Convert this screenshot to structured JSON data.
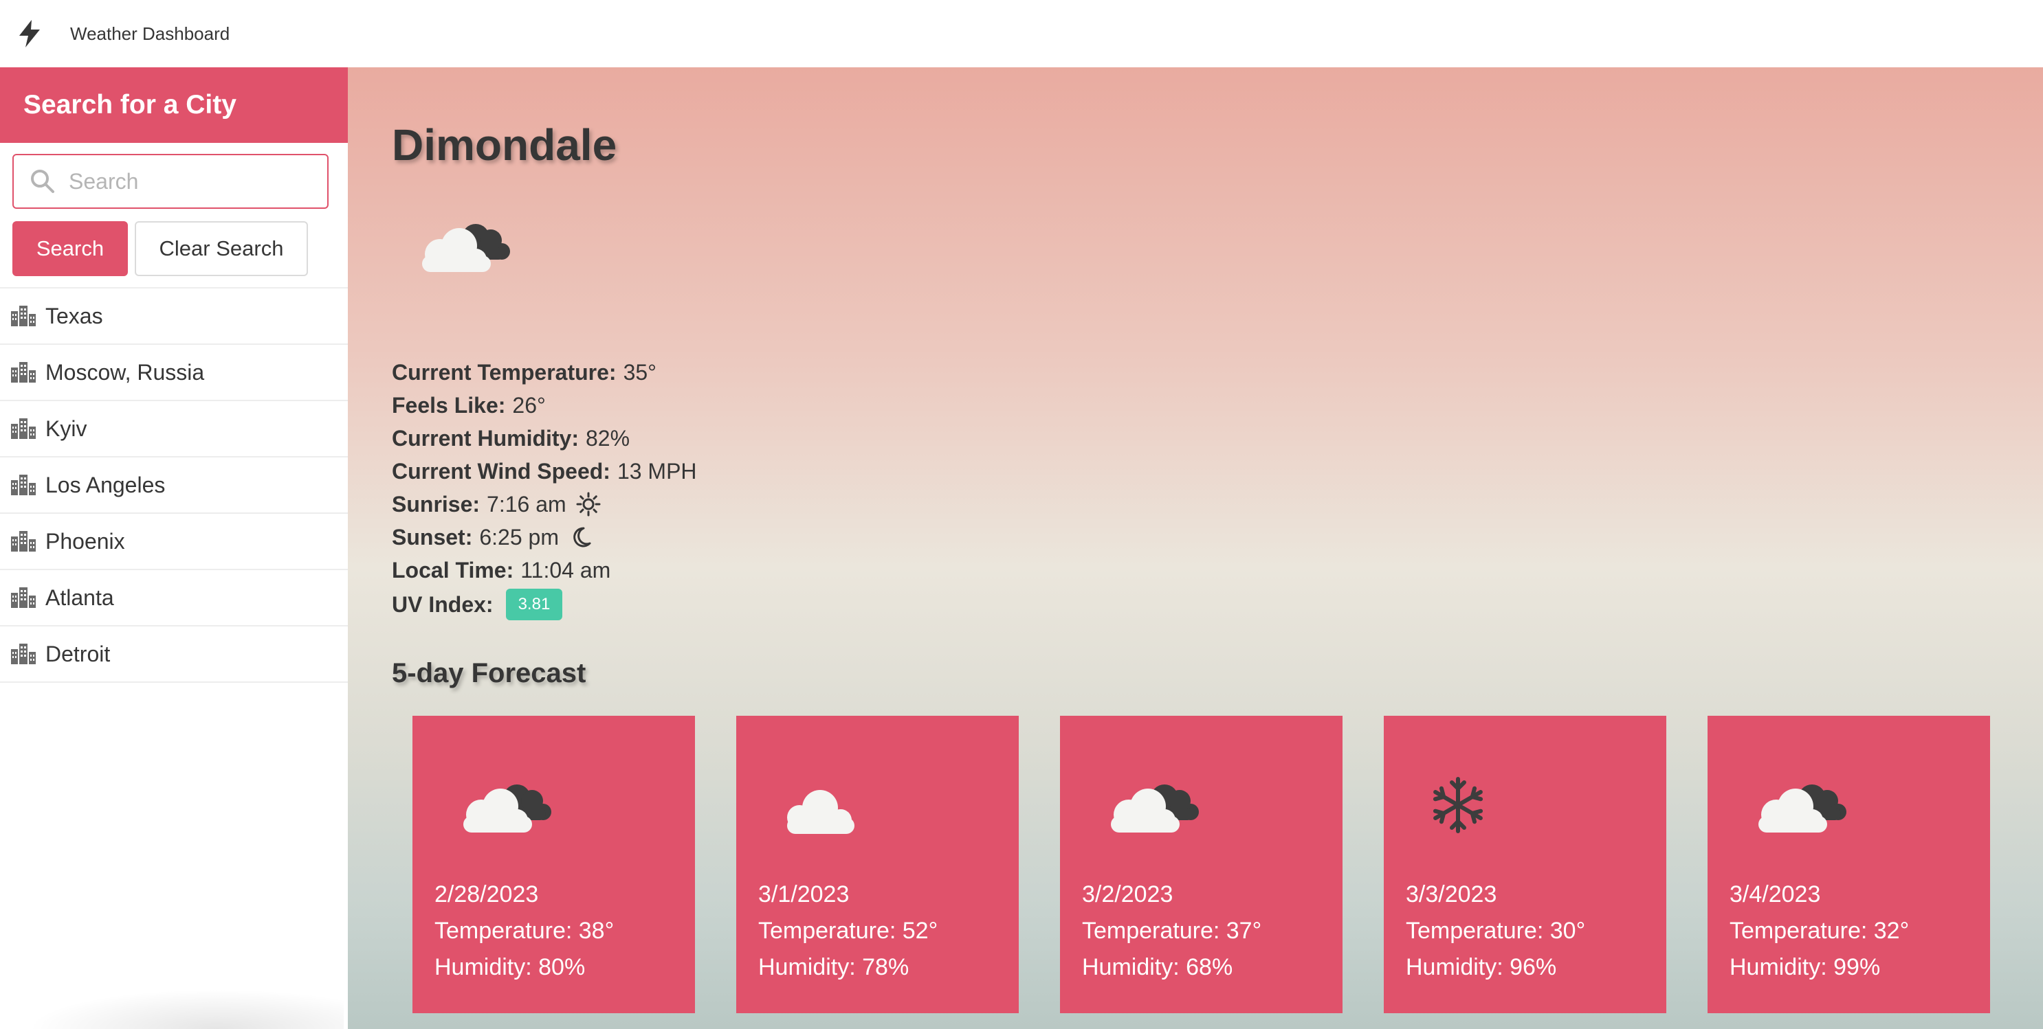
{
  "app": {
    "title": "Weather Dashboard",
    "brand_icon": "bolt-icon"
  },
  "sidebar": {
    "header": "Search for a City",
    "search": {
      "placeholder": "Search",
      "value": ""
    },
    "search_button": "Search",
    "clear_button": "Clear Search",
    "cities": [
      {
        "label": "Texas",
        "icon": "city-icon"
      },
      {
        "label": "Moscow, Russia",
        "icon": "city-icon"
      },
      {
        "label": "Kyiv",
        "icon": "city-icon"
      },
      {
        "label": "Los Angeles",
        "icon": "city-icon"
      },
      {
        "label": "Phoenix",
        "icon": "city-icon"
      },
      {
        "label": "Atlanta",
        "icon": "city-icon"
      },
      {
        "label": "Detroit",
        "icon": "city-icon"
      }
    ]
  },
  "current": {
    "city": "Dimondale",
    "icon": "cloudy-icon",
    "temperature_label": "Current Temperature:",
    "temperature": "35°",
    "feels_like_label": "Feels Like:",
    "feels_like": "26°",
    "humidity_label": "Current Humidity:",
    "humidity": "82%",
    "wind_label": "Current Wind Speed:",
    "wind": "13 MPH",
    "sunrise_label": "Sunrise:",
    "sunrise": "7:16 am",
    "sunset_label": "Sunset:",
    "sunset": "6:25 pm",
    "local_time_label": "Local Time:",
    "local_time": "11:04 am",
    "uv_label": "UV Index:",
    "uv": "3.81",
    "uv_color": "#48c9a6"
  },
  "forecast": {
    "title": "5-day Forecast",
    "days": [
      {
        "date": "2/28/2023",
        "temperature": "Temperature: 38°",
        "humidity": "Humidity: 80%",
        "icon": "cloudy-icon"
      },
      {
        "date": "3/1/2023",
        "temperature": "Temperature: 52°",
        "humidity": "Humidity: 78%",
        "icon": "cloud-icon"
      },
      {
        "date": "3/2/2023",
        "temperature": "Temperature: 37°",
        "humidity": "Humidity: 68%",
        "icon": "cloudy-icon"
      },
      {
        "date": "3/3/2023",
        "temperature": "Temperature: 30°",
        "humidity": "Humidity: 96%",
        "icon": "snowflake-icon"
      },
      {
        "date": "3/4/2023",
        "temperature": "Temperature: 32°",
        "humidity": "Humidity: 99%",
        "icon": "cloudy-icon"
      }
    ]
  },
  "colors": {
    "accent": "#e0526b",
    "text": "#363636"
  }
}
